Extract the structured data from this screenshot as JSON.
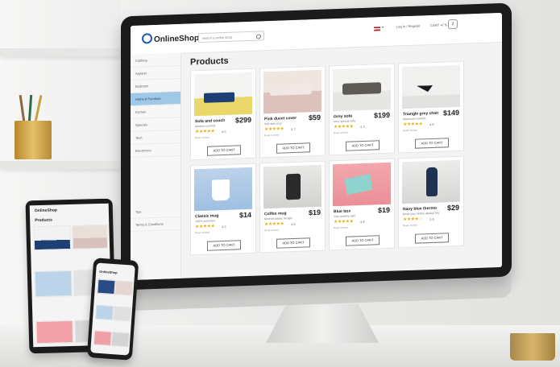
{
  "site": {
    "logo": "OnlineShop",
    "search_placeholder": "search a online shop",
    "lang": "▾",
    "auth": "Log In  /  Register",
    "cart_label": "CART: 47 $",
    "cart_count": "2"
  },
  "sidebar": {
    "items": [
      "Clothing",
      "Apparel",
      "Bedroom",
      "Home & Furniture",
      "Kitchen",
      "Specials",
      "Tech",
      "Electronics"
    ],
    "active_index": 3,
    "lower_items": [
      "Tips",
      "Terms & Conditions"
    ]
  },
  "page_title": "Products",
  "products": [
    {
      "name": "Sofa and couch",
      "desc": "Modern comfort",
      "price": "$299",
      "rating": "4.5",
      "stars": "★★★★★",
      "reviews": "Read reviews",
      "button": "ADD TO CART"
    },
    {
      "name": "Pink duvet cover",
      "desc": "Soft and cozy",
      "price": "$59",
      "rating": "4.7",
      "stars": "★★★★★",
      "reviews": "Read reviews",
      "button": "ADD TO CART"
    },
    {
      "name": "Grey sofa",
      "desc": "Very special sofa",
      "price": "$199",
      "rating": "4.3",
      "stars": "★★★★★",
      "reviews": "Read reviews",
      "button": "ADD TO CART"
    },
    {
      "name": "Triangle grey chair",
      "desc": "Maximum comfort",
      "price": "$149",
      "rating": "4.6",
      "stars": "★★★★★",
      "reviews": "Read reviews",
      "button": "ADD TO CART"
    },
    {
      "name": "Classic mug",
      "desc": "100% porcelain",
      "price": "$14",
      "rating": "4.2",
      "stars": "★★★★★",
      "reviews": "Read reviews",
      "button": "ADD TO CART"
    },
    {
      "name": "Coffee mug",
      "desc": "Mineral plastic design",
      "price": "$19",
      "rating": "4.8",
      "stars": "★★★★★",
      "reviews": "Read reviews",
      "button": "ADD TO CART"
    },
    {
      "name": "Blue box",
      "desc": "Your jewelry safe",
      "price": "$19",
      "rating": "4.6",
      "stars": "★★★★★",
      "reviews": "Read reviews",
      "button": "ADD TO CART"
    },
    {
      "name": "Navy blue thermo",
      "desc": "Keep your drinks always hot",
      "price": "$29",
      "rating": "3.9",
      "stars": "★★★★☆",
      "reviews": "Read reviews",
      "button": "ADD TO CART"
    }
  ],
  "tablet": {
    "logo": "OnlineShop",
    "title": "Products"
  },
  "phone": {
    "logo": "OnlineShop"
  }
}
